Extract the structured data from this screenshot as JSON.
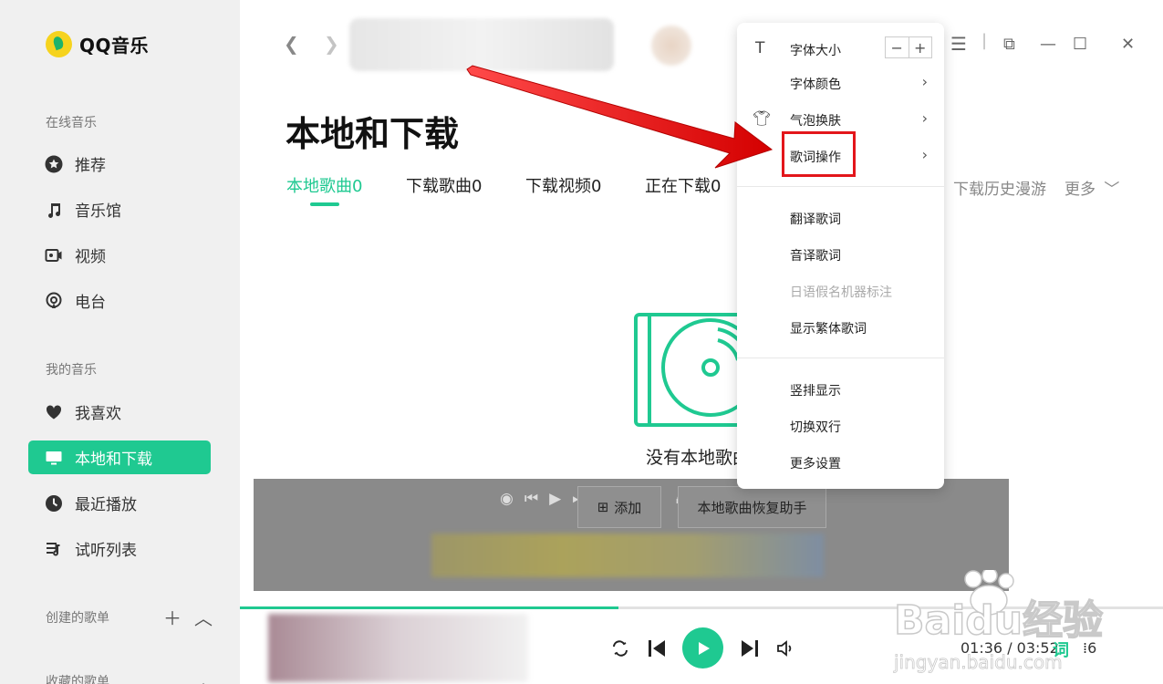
{
  "app": {
    "logo_text": "QQ音乐"
  },
  "sidebar": {
    "sections": [
      {
        "title": "在线音乐"
      },
      {
        "title": "我的音乐"
      },
      {
        "title": "创建的歌单"
      },
      {
        "title": "收藏的歌单"
      }
    ],
    "items": [
      {
        "label": "推荐",
        "icon": "star-icon"
      },
      {
        "label": "音乐馆",
        "icon": "music-note-icon"
      },
      {
        "label": "视频",
        "icon": "video-icon"
      },
      {
        "label": "电台",
        "icon": "radio-icon"
      },
      {
        "label": "我喜欢",
        "icon": "heart-icon"
      },
      {
        "label": "本地和下载",
        "icon": "monitor-icon",
        "active": true
      },
      {
        "label": "最近播放",
        "icon": "clock-icon"
      },
      {
        "label": "试听列表",
        "icon": "playlist-icon"
      }
    ]
  },
  "main": {
    "title": "本地和下载",
    "tabs": [
      {
        "label": "本地歌曲0",
        "active": true
      },
      {
        "label": "下载歌曲0"
      },
      {
        "label": "下载视频0"
      },
      {
        "label": "正在下载0"
      }
    ],
    "right_links": {
      "history": "下载历史漫游",
      "more": "更多"
    },
    "empty_text": "没有本地歌曲"
  },
  "overlay": {
    "add_button": "添加",
    "restore_button": "本地歌曲恢复助手"
  },
  "player": {
    "progress": 0.41,
    "time": "01:36 / 03:52",
    "lyric_label": "词",
    "queue_count": "6"
  },
  "menu": {
    "items": [
      {
        "label": "字体大小"
      },
      {
        "label": "字体颜色"
      },
      {
        "label": "气泡换肤"
      },
      {
        "label": "歌词操作"
      },
      {
        "label": "翻译歌词"
      },
      {
        "label": "音译歌词"
      },
      {
        "label": "日语假名机器标注",
        "disabled": true
      },
      {
        "label": "显示繁体歌词"
      },
      {
        "label": "竖排显示"
      },
      {
        "label": "切换双行"
      },
      {
        "label": "更多设置"
      }
    ]
  },
  "colors": {
    "accent": "#1fc991",
    "highlight": "#e3161b"
  },
  "watermark": {
    "text": "Baidu经验",
    "url_text": "jingyan.baidu.com"
  }
}
